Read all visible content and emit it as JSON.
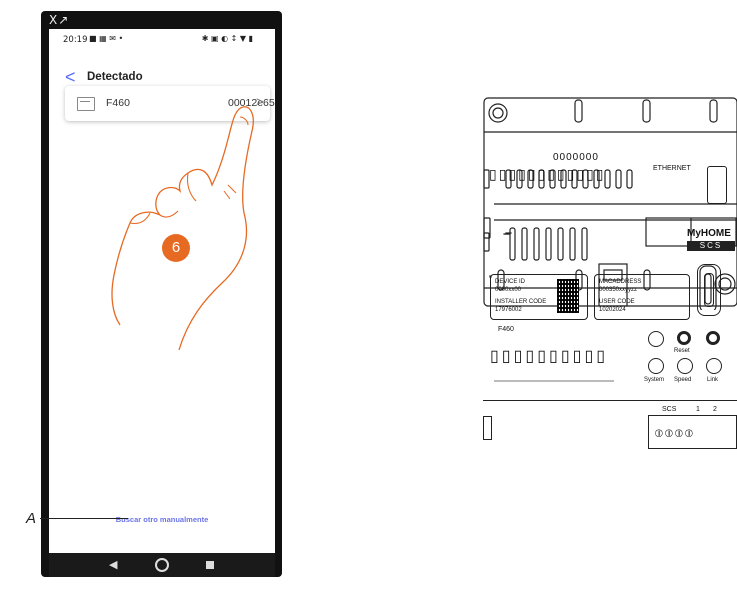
{
  "phone": {
    "top_glyph": "X↗",
    "status": {
      "time": "20:19",
      "left_icons": "■ ▦ ✉ •",
      "right_icons": "✱ ▣ ◐ ↕ ▼ ▮"
    },
    "header": {
      "back_symbol": "<",
      "title": "Detectado"
    },
    "device_card": {
      "name": "F460",
      "code": "00012e65",
      "chevron": ">"
    },
    "manual_link": "Buscar otro manualmente",
    "navbar": {
      "back": "◀",
      "home": "home",
      "recent": "recent"
    }
  },
  "step_badge": "6",
  "callout": {
    "label": "A"
  },
  "device": {
    "dots": "0000000",
    "ethernet": "ETHERNET",
    "brand_top": "MyHOME",
    "brand_bottom": "SCS",
    "left_label": {
      "line1": "DEVICE ID",
      "line2": "0000xx00",
      "line3": "INSTALLER CODE",
      "line4": "17976002"
    },
    "right_label": {
      "line1": "MACADDRESS",
      "line2": "000350xxyyzz",
      "line3": "USER CODE",
      "line4": "10202024"
    },
    "model": "F460",
    "buttons": {
      "reset": "Reset",
      "system": "System",
      "speed": "Speed",
      "link": "Link"
    },
    "terminals": {
      "scs": "SCS",
      "one": "1",
      "two": "2"
    }
  },
  "colors": {
    "accent": "#5a6cff",
    "link": "#6b74e8",
    "badge": "#e76a23",
    "hand_outline": "#e76a23"
  },
  "icons": [
    "chevron-left-icon",
    "device-icon",
    "chevron-right-icon",
    "hand-pointer-icon",
    "qr-code-icon",
    "ethernet-port-icon"
  ]
}
